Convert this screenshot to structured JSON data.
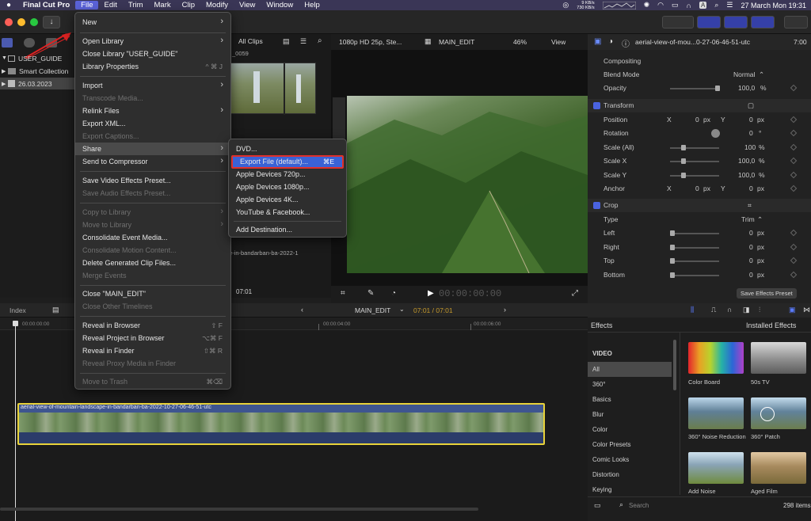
{
  "menubar": {
    "apple": "",
    "app": "Final Cut Pro",
    "items": [
      "File",
      "Edit",
      "Trim",
      "Mark",
      "Clip",
      "Modify",
      "View",
      "Window",
      "Help"
    ],
    "net_up": "9 KB/s",
    "net_down": "730 KB/s",
    "datetime": "27 March Mon  19:31",
    "input_source": "A"
  },
  "library": {
    "name": "USER_GUIDE",
    "smart_collections": "Smart Collection",
    "event": "26.03.2023"
  },
  "clips": {
    "filter": "All Clips",
    "clip_label_top": "_0059",
    "clip_label_bottom": "e-in-bandarban-ba-2022-1",
    "timecode": "07:01"
  },
  "viewer": {
    "format": "1080p HD 25p, Ste...",
    "project": "MAIN_EDIT",
    "zoom": "46%",
    "view": "View",
    "timecode": "00:00:00:00"
  },
  "inspector": {
    "clip_name": "aerial-view-of-mou...0-27-06-46-51-utc",
    "duration": "7:00",
    "compositing": "Compositing",
    "blend_mode_label": "Blend Mode",
    "blend_mode": "Normal",
    "opacity_label": "Opacity",
    "opacity": "100,0",
    "pct": "%",
    "transform": "Transform",
    "position_label": "Position",
    "x": "X",
    "y": "Y",
    "pos_x": "0",
    "pos_y": "0",
    "px": "px",
    "rotation_label": "Rotation",
    "rotation": "0",
    "deg": "°",
    "scale_all_label": "Scale (All)",
    "scale_all": "100",
    "scale_x_label": "Scale X",
    "scale_x": "100,0",
    "scale_y_label": "Scale Y",
    "scale_y": "100,0",
    "anchor_label": "Anchor",
    "anchor_x": "0",
    "anchor_y": "0",
    "crop": "Crop",
    "type_label": "Type",
    "type": "Trim",
    "left_label": "Left",
    "left": "0",
    "right_label": "Right",
    "right": "0",
    "top_label": "Top",
    "top": "0",
    "bottom_label": "Bottom",
    "bottom": "0",
    "save_preset": "Save Effects Preset"
  },
  "timeline": {
    "index": "Index",
    "project": "MAIN_EDIT",
    "timecode": "07:01 / 07:01",
    "ruler": [
      "00:00:00:00",
      "00:00:04:00",
      "00:00:06:00"
    ],
    "clip_name": "aerial-view-of-mountain-landscape-in-bandarban-ba-2022-10-27-06-46-51-utc"
  },
  "effects": {
    "title": "Effects",
    "installed": "Installed Effects",
    "video": "VIDEO",
    "categories": [
      "All",
      "360°",
      "Basics",
      "Blur",
      "Color",
      "Color Presets",
      "Comic Looks",
      "Distortion",
      "Keying"
    ],
    "thumbs": [
      {
        "label": "Color Board"
      },
      {
        "label": "50s TV"
      },
      {
        "label": "360° Noise Reduction"
      },
      {
        "label": "360° Patch"
      },
      {
        "label": "Add Noise"
      },
      {
        "label": "Aged Film"
      }
    ],
    "search_placeholder": "Search",
    "count": "298 items"
  },
  "file_menu": {
    "items": [
      {
        "label": "New",
        "arrow": true
      },
      {
        "label": "Open Library",
        "arrow": true
      },
      {
        "label": "Close Library \"USER_GUIDE\""
      },
      {
        "label": "Library Properties",
        "sc": "^ ⌘ J"
      },
      {
        "label": "Import",
        "arrow": true
      },
      {
        "label": "Transcode Media...",
        "dis": true
      },
      {
        "label": "Relink Files",
        "arrow": true
      },
      {
        "label": "Export XML..."
      },
      {
        "label": "Export Captions...",
        "dis": true
      },
      {
        "label": "Share",
        "arrow": true,
        "hl": true
      },
      {
        "label": "Send to Compressor",
        "arrow": true
      },
      {
        "label": "Save Video Effects Preset..."
      },
      {
        "label": "Save Audio Effects Preset...",
        "dis": true
      },
      {
        "label": "Copy to Library",
        "arrow": true,
        "dis": true
      },
      {
        "label": "Move to Library",
        "arrow": true,
        "dis": true
      },
      {
        "label": "Consolidate Event Media..."
      },
      {
        "label": "Consolidate Motion Content...",
        "dis": true
      },
      {
        "label": "Delete Generated Clip Files..."
      },
      {
        "label": "Merge Events",
        "dis": true
      },
      {
        "label": "Close \"MAIN_EDIT\""
      },
      {
        "label": "Close Other Timelines",
        "dis": true
      },
      {
        "label": "Reveal in Browser",
        "sc": "⇧ F"
      },
      {
        "label": "Reveal Project in Browser",
        "sc": "⌥⌘ F"
      },
      {
        "label": "Reveal in Finder",
        "sc": "⇧⌘ R"
      },
      {
        "label": "Reveal Proxy Media in Finder",
        "dis": true
      },
      {
        "label": "Move to Trash",
        "sc": "⌘⌫",
        "dis": true
      }
    ]
  },
  "share_menu": {
    "items": [
      {
        "label": "DVD..."
      },
      {
        "label": "Export File (default)...",
        "sc": "⌘E",
        "hl": true
      },
      {
        "label": "Apple Devices 720p..."
      },
      {
        "label": "Apple Devices 1080p..."
      },
      {
        "label": "Apple Devices 4K..."
      },
      {
        "label": "YouTube & Facebook..."
      },
      {
        "label": "Add Destination..."
      }
    ]
  },
  "colors": {
    "menubar": "#3a3656",
    "accent": "#3a62d6",
    "highlight_box": "#e0302b",
    "clip_border": "#e8d23a"
  }
}
